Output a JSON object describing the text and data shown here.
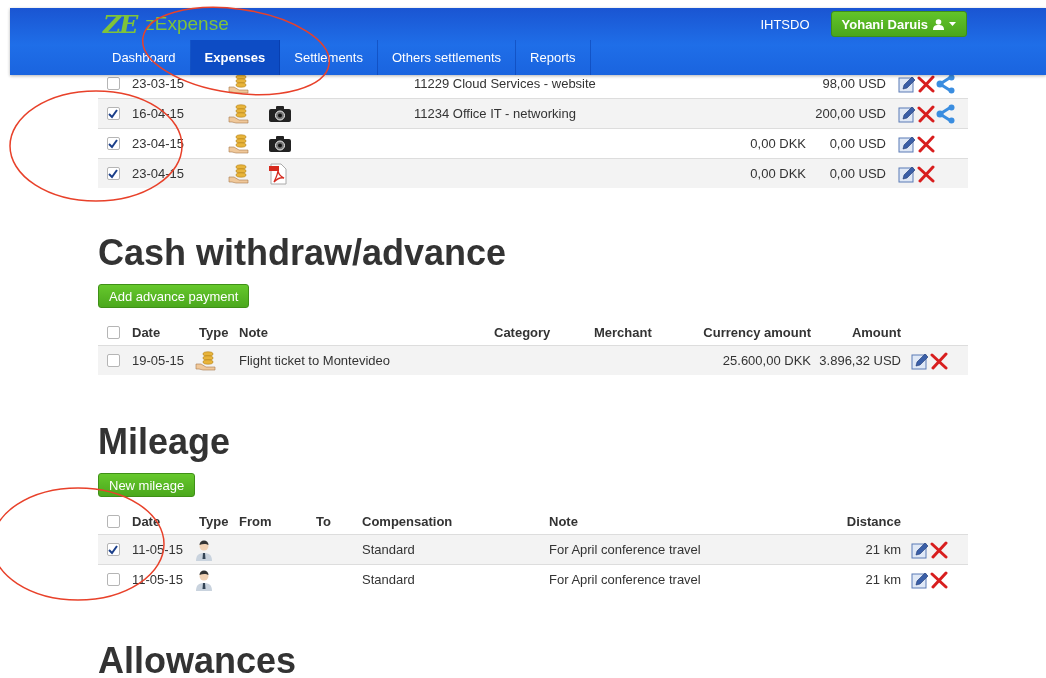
{
  "header": {
    "logo_mark": "ZE",
    "logo_text": "zExpense",
    "organization": "IHTSDO",
    "user_button": "Yohani Daruis"
  },
  "nav": [
    {
      "label": "Dashboard",
      "selected": false
    },
    {
      "label": "Expenses",
      "selected": true
    },
    {
      "label": "Settlements",
      "selected": false
    },
    {
      "label": "Others settlements",
      "selected": false
    },
    {
      "label": "Reports",
      "selected": false
    }
  ],
  "expenses": {
    "rows": [
      {
        "checked": false,
        "date": "23-03-15",
        "photo": false,
        "pdf": false,
        "note": "11229 Cloud Services - website",
        "amount": "98,00 USD",
        "shareable": true
      },
      {
        "checked": true,
        "date": "16-04-15",
        "photo": true,
        "pdf": false,
        "note": "11234 Office IT - networking",
        "amount": "200,00 USD",
        "shareable": true
      },
      {
        "checked": true,
        "date": "23-04-15",
        "photo": true,
        "pdf": false,
        "currency_amount": "0,00 DKK",
        "amount": "0,00 USD",
        "shareable": false
      },
      {
        "checked": true,
        "date": "23-04-15",
        "photo": false,
        "pdf": true,
        "currency_amount": "0,00 DKK",
        "amount": "0,00 USD",
        "shareable": false
      }
    ]
  },
  "cash": {
    "title": "Cash withdraw/advance",
    "button": "Add advance payment",
    "all_checked": false,
    "columns": [
      "Date",
      "Type",
      "Note",
      "Category",
      "Merchant",
      "Currency amount",
      "Amount"
    ],
    "rows": [
      {
        "checked": false,
        "date": "19-05-15",
        "note": "Flight ticket to Montevideo",
        "currency_amount": "25.600,00 DKK",
        "amount": "3.896,32 USD"
      }
    ]
  },
  "mileage": {
    "title": "Mileage",
    "button": "New mileage",
    "all_checked": false,
    "columns": [
      "Date",
      "Type",
      "From",
      "To",
      "Compensation",
      "Note",
      "Distance"
    ],
    "rows": [
      {
        "checked": true,
        "date": "11-05-15",
        "compensation": "Standard",
        "note": "For April conference travel",
        "distance": "21 km"
      },
      {
        "checked": false,
        "date": "11-05-15",
        "compensation": "Standard",
        "note": "For April conference travel",
        "distance": "21 km"
      }
    ]
  },
  "allowances": {
    "title": "Allowances"
  }
}
